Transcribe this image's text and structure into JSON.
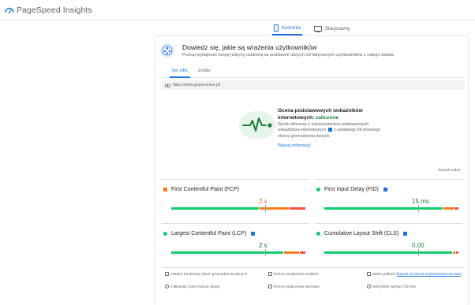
{
  "app": {
    "brand": "PageSpeed Insights"
  },
  "device_tabs": {
    "mobile": "Komórka",
    "desktop": "Stacjonarny"
  },
  "intro": {
    "title": "Dowiedz się, jakie są wrażenia użytkowników",
    "subtitle": "Poznaj wydajność swojej witryny ustaloną na podstawie danych od faktycznych użytkowników z całego świata."
  },
  "tabs": {
    "url": "Ten URL",
    "origin": "Źródło"
  },
  "url": "https://www.grupa-tense.pl/",
  "assessment": {
    "title": "Ocena podstawowych wskaźników internetowych:",
    "status": "zaliczone",
    "desc_part1": "Wynik obliczony z wykorzystaniem podstawowych wskaźników internetowych",
    "desc_part2": "z ostatniego 28-dniowego okresu gromadzenia danych.",
    "link": "Więcej informacji"
  },
  "expand_label": "Rozwiń widok",
  "metrics": {
    "fcp": {
      "name": "First Contentful Paint (FCP)",
      "value": "2 s",
      "value_color": "#e8710a",
      "status": "needs-improvement",
      "green_share": 0.66,
      "orange_share": 0.22,
      "red_share": 0.12,
      "marker": 0.7
    },
    "fid": {
      "name": "First Input Delay (FID)",
      "value": "15 ms",
      "value_color": "#188038",
      "status": "good",
      "green_share": 0.89,
      "orange_share": 0.08,
      "red_share": 0.03,
      "marker": 0.7
    },
    "lcp": {
      "name": "Largest Contentful Paint (LCP)",
      "value": "2 s",
      "value_color": "#188038",
      "status": "good",
      "green_share": 0.84,
      "orange_share": 0.12,
      "red_share": 0.04,
      "marker": 0.7
    },
    "cls": {
      "name": "Cumulative Layout Shift (CLS)",
      "value": "0.00",
      "value_color": "#188038",
      "status": "good",
      "green_share": 0.96,
      "orange_share": 0.02,
      "red_share": 0.02,
      "marker": 0.7
    }
  },
  "footer": {
    "period": "Ostatni 28-dniowy okres gromadzenia danych",
    "devices": "Różne urządzenia mobilne",
    "samples": "Wiele próbek (",
    "samples_link": "Raport na temat użytkowania Chrome",
    "samples_end": ")",
    "duration": "Całkowity czas trwania wizyty",
    "network": "Różne połączenia sieciowe",
    "chrome": "Wszystkie wersje Chrome"
  },
  "colors": {
    "accent": "#1a73e8",
    "good": "#0cce6b",
    "average": "#fa7b17",
    "poor": "#ff4e42"
  }
}
